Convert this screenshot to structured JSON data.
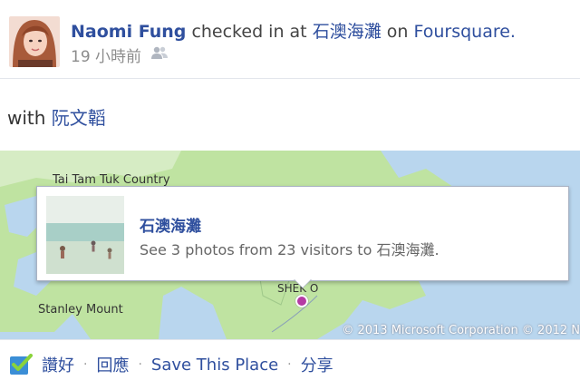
{
  "post": {
    "author": "Naomi Fung",
    "action": "checked in at",
    "place": "石澳海灘",
    "on_text": "on",
    "service": "Foursquare.",
    "time": "19 小時前"
  },
  "with_text": "with",
  "with_friend": "阮文韜",
  "map": {
    "label_top": "Tai Tam Tuk Country",
    "label_left": "Stanley Mount",
    "label_pin": "SHEK O",
    "copyright": "© 2013 Microsoft Corporation © 2012 N"
  },
  "popup": {
    "title": "石澳海灘",
    "subtitle": "See 3 photos from 23 visitors to 石澳海灘."
  },
  "actions": {
    "like": "讚好",
    "comment": "回應",
    "save": "Save This Place",
    "share": "分享"
  },
  "colors": {
    "link": "#2f4f9e",
    "water": "#b9d6ee",
    "land": "#bfe3a1",
    "pin": "#b53aa4"
  },
  "icons": [
    "friends-audience-icon",
    "foursquare-check-icon",
    "place-pin-icon"
  ]
}
